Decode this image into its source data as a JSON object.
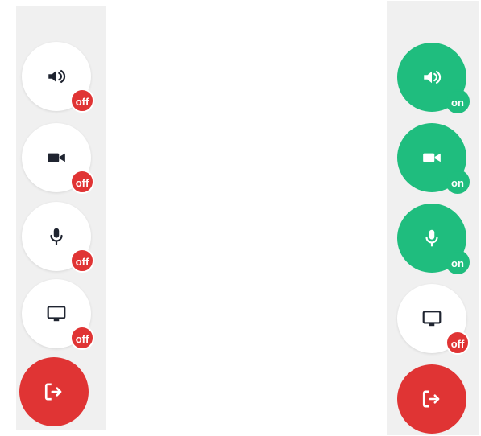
{
  "colors": {
    "panel_bg": "#f0f0f0",
    "button_off_bg": "#ffffff",
    "icon_dark": "#1f2430",
    "on_green": "#1fbd7e",
    "off_red": "#e03434",
    "leave_red": "#e03434"
  },
  "left_panel": {
    "controls": [
      {
        "icon": "speaker-icon",
        "status": "off"
      },
      {
        "icon": "camera-icon",
        "status": "off"
      },
      {
        "icon": "microphone-icon",
        "status": "off"
      },
      {
        "icon": "screen-share-icon",
        "status": "off"
      }
    ],
    "leave": {
      "icon": "exit-icon"
    }
  },
  "right_panel": {
    "controls": [
      {
        "icon": "speaker-icon",
        "status": "on"
      },
      {
        "icon": "camera-icon",
        "status": "on"
      },
      {
        "icon": "microphone-icon",
        "status": "on"
      },
      {
        "icon": "screen-share-icon",
        "status": "off"
      }
    ],
    "leave": {
      "icon": "exit-icon"
    }
  }
}
